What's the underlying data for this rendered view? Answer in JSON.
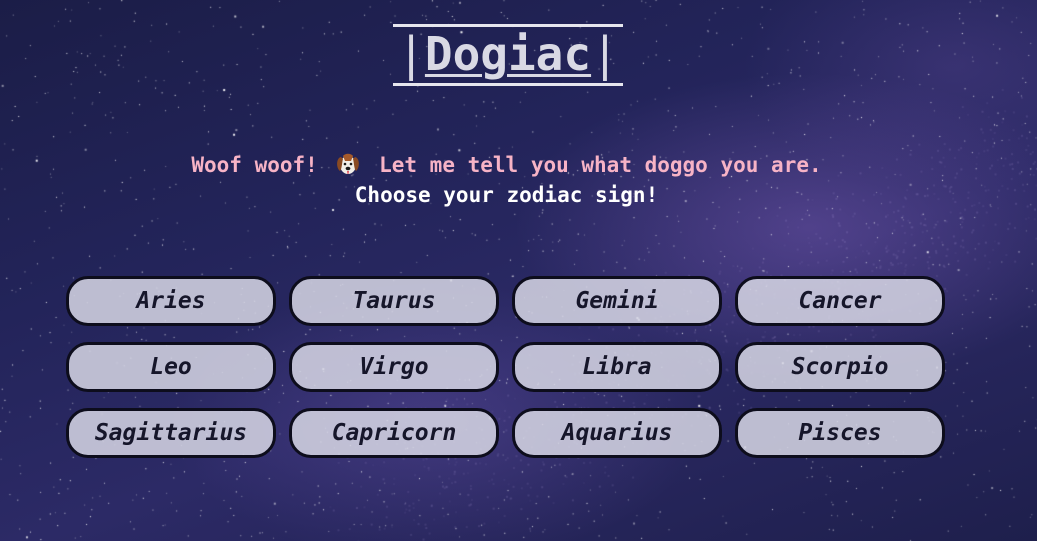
{
  "header": {
    "bar_left": "|",
    "title": "Dogiac",
    "bar_right": "|"
  },
  "intro": {
    "line1_before": "Woof woof!",
    "dog_icon": "dog-face-icon",
    "line1_after": "Let me tell you what doggo you are.",
    "line2": "Choose your zodiac sign!"
  },
  "signs": [
    {
      "label": "Aries"
    },
    {
      "label": "Taurus"
    },
    {
      "label": "Gemini"
    },
    {
      "label": "Cancer"
    },
    {
      "label": "Leo"
    },
    {
      "label": "Virgo"
    },
    {
      "label": "Libra"
    },
    {
      "label": "Scorpio"
    },
    {
      "label": "Sagittarius"
    },
    {
      "label": "Capricorn"
    },
    {
      "label": "Aquarius"
    },
    {
      "label": "Pisces"
    }
  ],
  "colors": {
    "intro_accent": "#f7b3c6",
    "button_background": "#d6d6e4",
    "button_border": "#0d0d1c",
    "title_color": "#d9d9e4"
  }
}
